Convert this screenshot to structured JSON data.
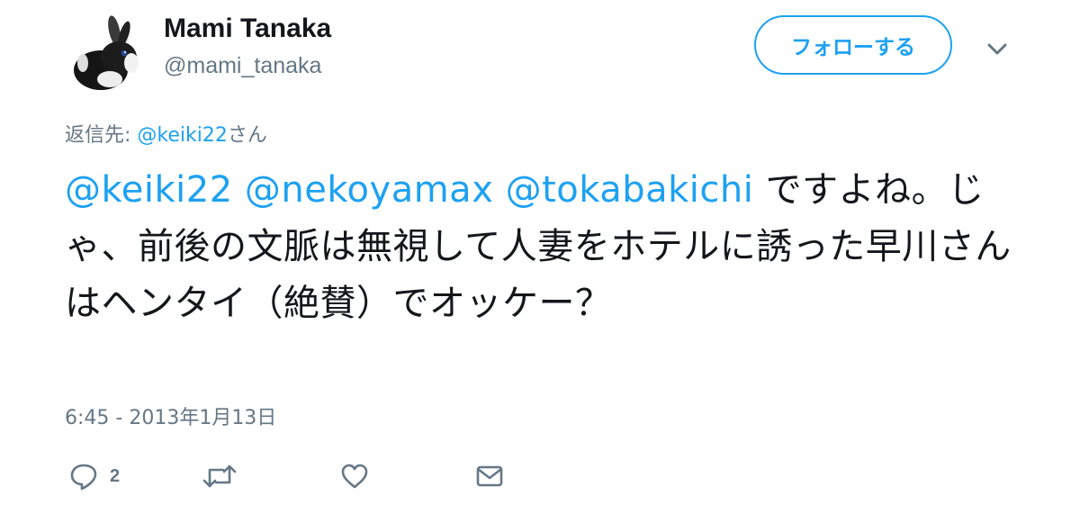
{
  "user": {
    "display_name": "Mami Tanaka",
    "handle": "@mami_tanaka",
    "avatar_icon": "rabbit-avatar"
  },
  "follow_button": {
    "label": "フォローする"
  },
  "menu": {
    "icon": "chevron-down-icon"
  },
  "reply_context": {
    "prefix": "返信先: ",
    "mention": "@keiki22",
    "suffix": "さん"
  },
  "tweet": {
    "mention_1": "@keiki22",
    "mention_2": "@nekoyamax",
    "mention_3": "@tokabakichi",
    "body": "ですよね。じゃ、前後の文脈は無視して人妻をホテルに誘った早川さんはヘンタイ（絶賛）でオッケー？",
    "timestamp": "6:45 - 2013年1月13日"
  },
  "actions": {
    "reply": {
      "icon": "reply-icon",
      "count": "2"
    },
    "retweet": {
      "icon": "retweet-icon"
    },
    "like": {
      "icon": "heart-icon"
    },
    "message": {
      "icon": "envelope-icon"
    }
  },
  "colors": {
    "accent": "#1da1f2",
    "text": "#14171a",
    "secondary": "#657786"
  }
}
